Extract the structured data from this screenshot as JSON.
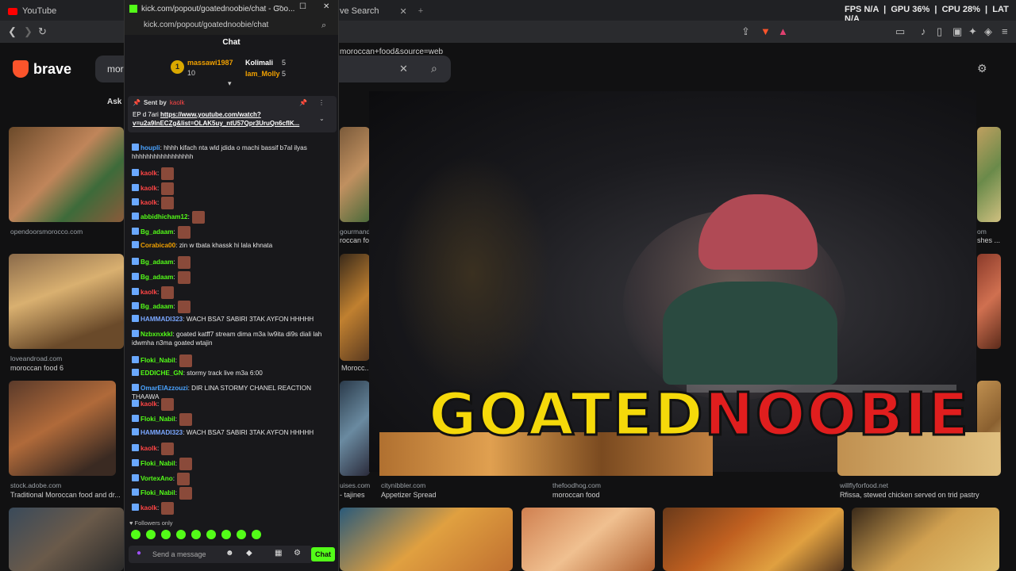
{
  "browser": {
    "tabs": [
      {
        "label": "YouTube"
      },
      {
        "label": "ve Search"
      }
    ],
    "url_fragment": "moroccan+food&source=web",
    "stats": {
      "fps_label": "FPS",
      "fps": "N/A",
      "gpu_label": "GPU",
      "gpu": "36%",
      "cpu_label": "CPU",
      "cpu": "28%",
      "lat_label": "LAT",
      "lat": "N/A"
    }
  },
  "brave": {
    "logo": "brave",
    "search_value": "mor",
    "ask_label": "Ask",
    "results": [
      {
        "source": "opendoorsmorocco.com",
        "title": ""
      },
      {
        "source": "loveandroad.com",
        "title": "moroccan food 6"
      },
      {
        "source": "stock.adobe.com",
        "title": "Traditional Moroccan food and dr..."
      },
      {
        "source": "gourmand",
        "title": "roccan foo"
      },
      {
        "source": "Morocc...",
        "title": ""
      },
      {
        "source": "uises.com",
        "title": "- tajines"
      },
      {
        "source": "citynibbler.com",
        "title": "Appetizer Spread"
      },
      {
        "source": "thefoodhog.com",
        "title": "moroccan food"
      },
      {
        "source": "willflyforfood.net",
        "title": "Rfissa, stewed chicken served on trid pastry"
      },
      {
        "source": "om",
        "title": "shes ..."
      }
    ]
  },
  "overlay": {
    "logo_left": "GOATED",
    "logo_right": "NOOBIE"
  },
  "colors": {
    "kick_green": "#53fc18",
    "brand_orange": "#fb542b",
    "logo_yellow": "#f5d90a",
    "logo_red": "#e01e1e"
  },
  "popout": {
    "window_title": "kick.com/popout/goatednoobie/chat - Goo...",
    "url": "kick.com/popout/goatednoobie/chat",
    "chat_title": "Chat",
    "leaderboard": [
      {
        "rank": "1",
        "name": "massawi1987",
        "count": "10"
      },
      {
        "name": "Kolimali",
        "count": "5"
      },
      {
        "name": "Iam_Molly",
        "count": "5"
      }
    ],
    "pinned": {
      "sent_by": "Sent by",
      "sender": "kaolk",
      "text": "EP d 7ari",
      "link": "https://www.youtube.com/watch?v=u2a9lnECZg&list=OLAK5uy_ntU57Qpr3UruQn6cflK..."
    },
    "messages": [
      {
        "user": "houpli",
        "color": "#4aa3ff",
        "text": ": hhhh kifach nta wld jdida o machi bassif b7al ilyas hhhhhhhhhhhhhhhhh"
      },
      {
        "user": "kaolk",
        "color": "#ff4545",
        "text": ":"
      },
      {
        "user": "kaolk",
        "color": "#ff4545",
        "text": ":"
      },
      {
        "user": "kaolk",
        "color": "#ff4545",
        "text": ":"
      },
      {
        "user": "abbidhicham12",
        "color": "#53fc18",
        "text": ":"
      },
      {
        "user": "Bg_adaam",
        "color": "#53fc18",
        "text": ":"
      },
      {
        "user": "Corabica00",
        "color": "#f0a000",
        "text": ": zin w tbata khassk hi lala khnata"
      },
      {
        "user": "Bg_adaam",
        "color": "#53fc18",
        "text": ":"
      },
      {
        "user": "Bg_adaam",
        "color": "#53fc18",
        "text": ":"
      },
      {
        "user": "kaolk",
        "color": "#ff4545",
        "text": ":"
      },
      {
        "user": "Bg_adaam",
        "color": "#53fc18",
        "text": ":"
      },
      {
        "user": "HAMMADI323",
        "color": "#7aa7ff",
        "text": ": WACH BSA7 SABIRI 3TAK AYFON HHHHH"
      },
      {
        "user": "Nzbxnxkkl",
        "color": "#53fc18",
        "text": ": goated katff7 stream dima m3a lw9ita di9s diali lah idwmha n3ma goated wtajin"
      },
      {
        "user": "Floki_Nabil",
        "color": "#53fc18",
        "text": ":"
      },
      {
        "user": "EDDICHE_GN",
        "color": "#53fc18",
        "text": ": stormy track live m3a 6:00"
      },
      {
        "user": "OmarElAzzouzi",
        "color": "#4aa3ff",
        "text": ": DIR LINA STORMY CHANEL REACTION THAAWA"
      },
      {
        "user": "kaolk",
        "color": "#ff4545",
        "text": ":"
      },
      {
        "user": "Floki_Nabil",
        "color": "#53fc18",
        "text": ":"
      },
      {
        "user": "HAMMADI323",
        "color": "#7aa7ff",
        "text": ": WACH BSA7 SABIRI 3TAK AYFON HHHHH"
      },
      {
        "user": "kaolk",
        "color": "#ff4545",
        "text": ":"
      },
      {
        "user": "Floki_Nabil",
        "color": "#53fc18",
        "text": ":"
      },
      {
        "user": "VortexAno",
        "color": "#53fc18",
        "text": ":"
      },
      {
        "user": "Floki_Nabil",
        "color": "#53fc18",
        "text": ":"
      },
      {
        "user": "kaolk",
        "color": "#ff4545",
        "text": ":"
      }
    ],
    "followers_only": "Followers only",
    "input_placeholder": "Send a message",
    "send_label": "Chat"
  }
}
